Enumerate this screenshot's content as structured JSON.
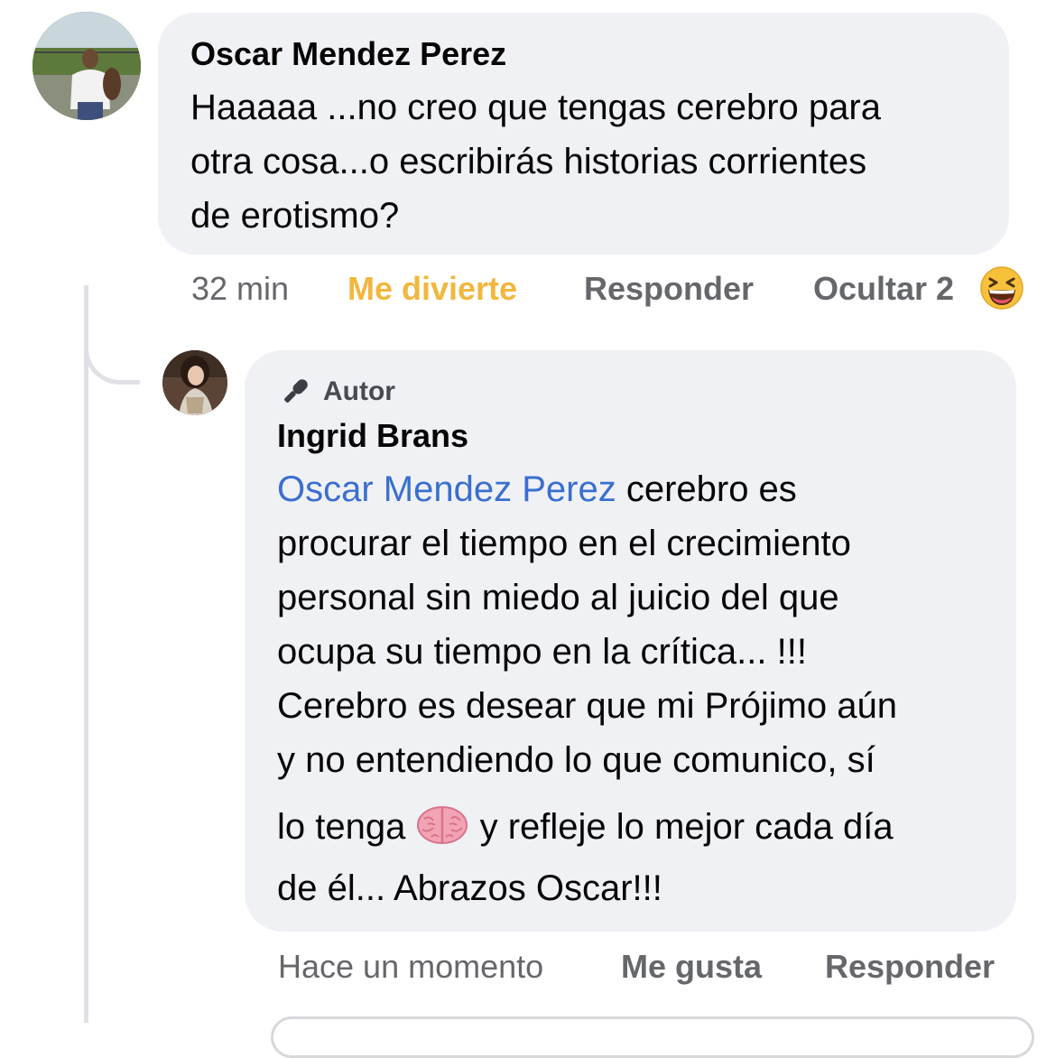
{
  "comment": {
    "author": "Oscar Mendez Perez",
    "text_lines": [
      "Haaaaa ...no creo que tengas cerebro para",
      "otra cosa...o escribirás historias corrientes",
      "de erotismo?"
    ],
    "time": "32 min",
    "reaction_label": "Me divierte",
    "reply_label": "Responder",
    "hide_label": "Ocultar 2",
    "reaction_emoji": "laughing-emoji"
  },
  "reply": {
    "badge_label": "Autor",
    "author": "Ingrid Brans",
    "mention": "Oscar Mendez Perez",
    "line1_rest": " cerebro es",
    "lines": [
      "procurar el tiempo en el crecimiento",
      "personal sin miedo al juicio del que",
      "ocupa su tiempo en la crítica... !!!",
      "Cerebro es desear que mi Prójimo aún",
      "y no entendiendo lo que comunico, sí"
    ],
    "line7_before_emoji": "lo tenga",
    "line7_emoji": "brain-emoji",
    "line7_after_emoji": "y refleje lo mejor cada día",
    "last_line": "de él... Abrazos Oscar!!!",
    "time": "Hace un momento",
    "like_label": "Me gusta",
    "reply_label": "Responder"
  },
  "colors": {
    "bubble": "#f0f1f4",
    "mention": "#3a6fcf",
    "reaction": "#f1b73e",
    "meta": "#65676b"
  }
}
